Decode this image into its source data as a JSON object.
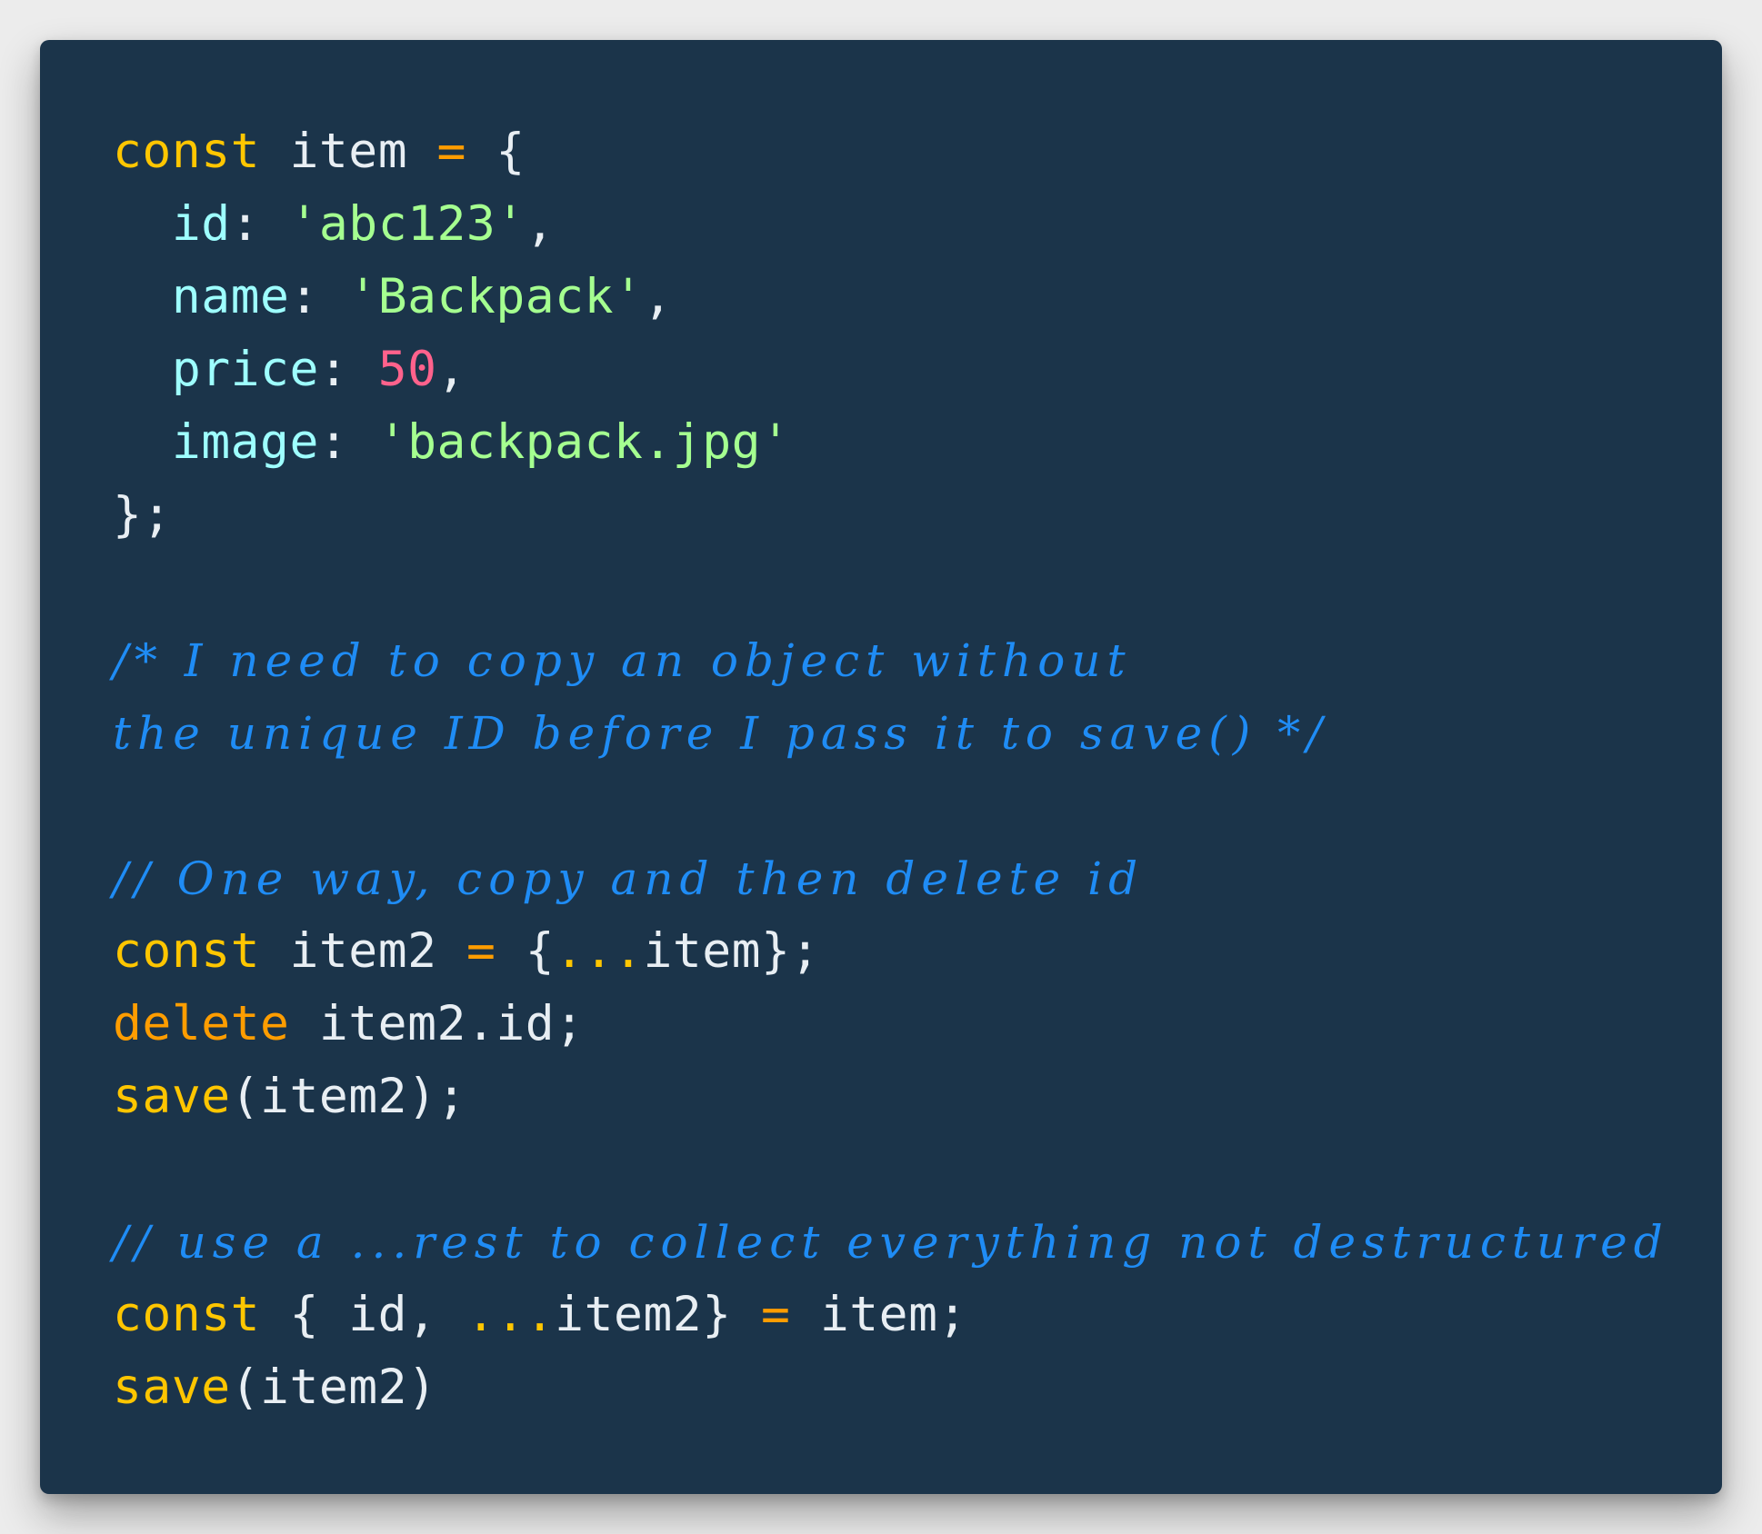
{
  "code": {
    "line1": {
      "kw": "const",
      "sp1": " ",
      "name": "item",
      "sp2": " ",
      "op": "=",
      "sp3": " ",
      "brace": "{"
    },
    "line2": {
      "indent": "  ",
      "prop": "id",
      "colon": ": ",
      "val": "'abc123'",
      "end": ","
    },
    "line3": {
      "indent": "  ",
      "prop": "name",
      "colon": ": ",
      "val": "'Backpack'",
      "end": ","
    },
    "line4": {
      "indent": "  ",
      "prop": "price",
      "colon": ": ",
      "val": "50",
      "end": ","
    },
    "line5": {
      "indent": "  ",
      "prop": "image",
      "colon": ": ",
      "val": "'backpack.jpg'"
    },
    "line6": {
      "text": "};"
    },
    "line8": {
      "text": "/* I need to copy an object without"
    },
    "line9": {
      "text": "the unique ID before I pass it to save() */"
    },
    "line11": {
      "text": "// One way, copy and then delete id"
    },
    "line12": {
      "kw": "const",
      "sp1": " ",
      "name": "item2",
      "sp2": " ",
      "op": "=",
      "sp3": " ",
      "brace": "{",
      "spread": "...",
      "rest": "item};"
    },
    "line13": {
      "kw": "delete",
      "rest": " item2.id;"
    },
    "line14": {
      "fn": "save",
      "rest": "(item2);"
    },
    "line16": {
      "text": "// use a ...rest to collect everything not destructured"
    },
    "line17": {
      "kw": "const",
      "pre": " { id, ",
      "spread": "...",
      "mid": "item2} ",
      "op": "=",
      "rest": " item;"
    },
    "line18": {
      "fn": "save",
      "rest": "(item2)"
    }
  }
}
